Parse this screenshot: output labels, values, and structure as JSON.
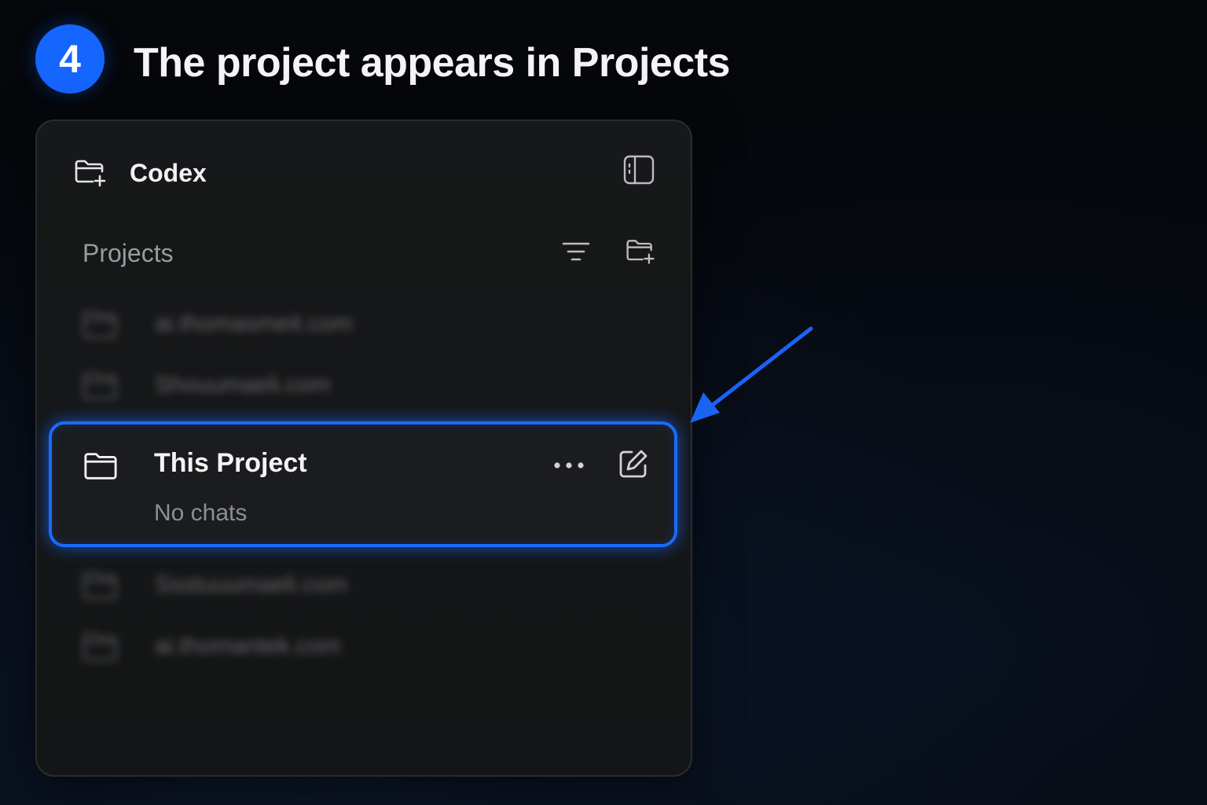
{
  "step": {
    "number": "4",
    "title": "The project appears in Projects"
  },
  "app": {
    "name": "Codex",
    "icons": {
      "app": "folder-plus-icon",
      "sidebar_toggle": "sidebar-toggle-icon"
    }
  },
  "projects": {
    "label": "Projects",
    "icons": {
      "filter": "filter-icon",
      "new_project": "folder-plus-icon"
    },
    "items_above": [
      {
        "label": "ai.thomasmeit.com"
      },
      {
        "label": "Shouumaeli.com"
      }
    ],
    "selected": {
      "name": "This Project",
      "subtitle": "No chats",
      "icons": {
        "folder": "folder-icon",
        "more": "more-icon",
        "edit": "edit-icon"
      }
    },
    "items_below": [
      {
        "label": "Ssstuuumaeli.com"
      },
      {
        "label": "ai.thomantek.com"
      }
    ]
  },
  "colors": {
    "accent": "#1a6bff",
    "badge": "#1565ff",
    "panel": "#161718",
    "background": "#05070b"
  }
}
